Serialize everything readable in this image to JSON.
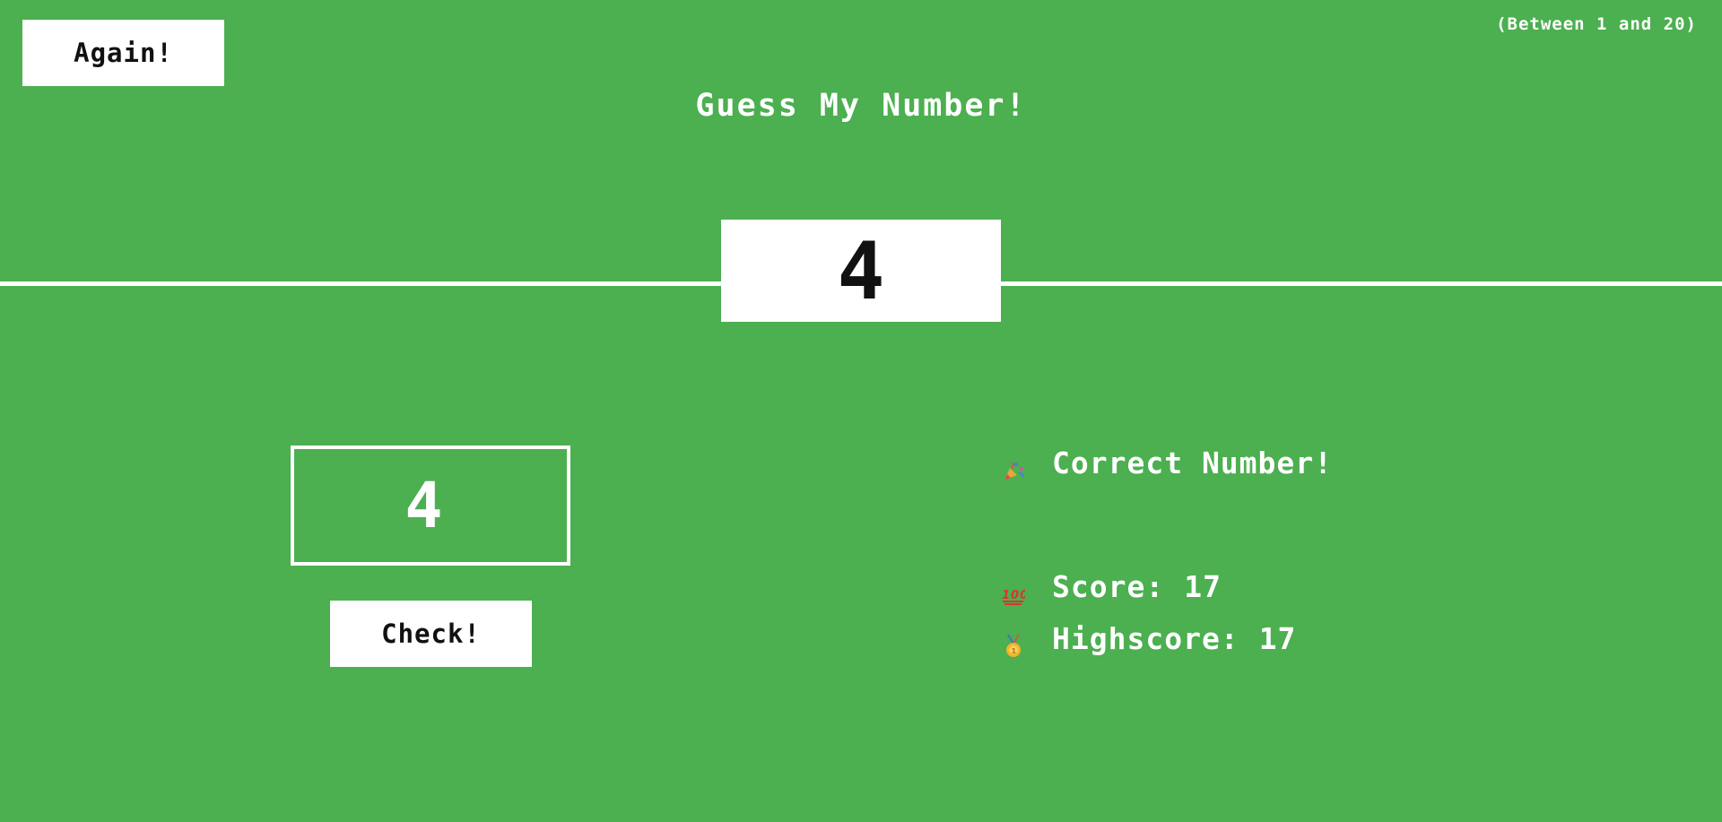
{
  "header": {
    "again_label": "Again!",
    "range_hint": "(Between 1 and 20)",
    "title": "Guess My Number!"
  },
  "secret": {
    "number": "4"
  },
  "input": {
    "guess_value": "4"
  },
  "actions": {
    "check_label": "Check!"
  },
  "status": {
    "message": "Correct Number!",
    "message_icon": "party-popper-icon",
    "score_label": "Score:",
    "score_value": "17",
    "score_icon": "hundred-points-icon",
    "highscore_label": "Highscore:",
    "highscore_value": "17",
    "highscore_icon": "medal-icon"
  },
  "colors": {
    "background": "#4caf50",
    "foreground": "#ffffff",
    "button_text": "#111111"
  }
}
